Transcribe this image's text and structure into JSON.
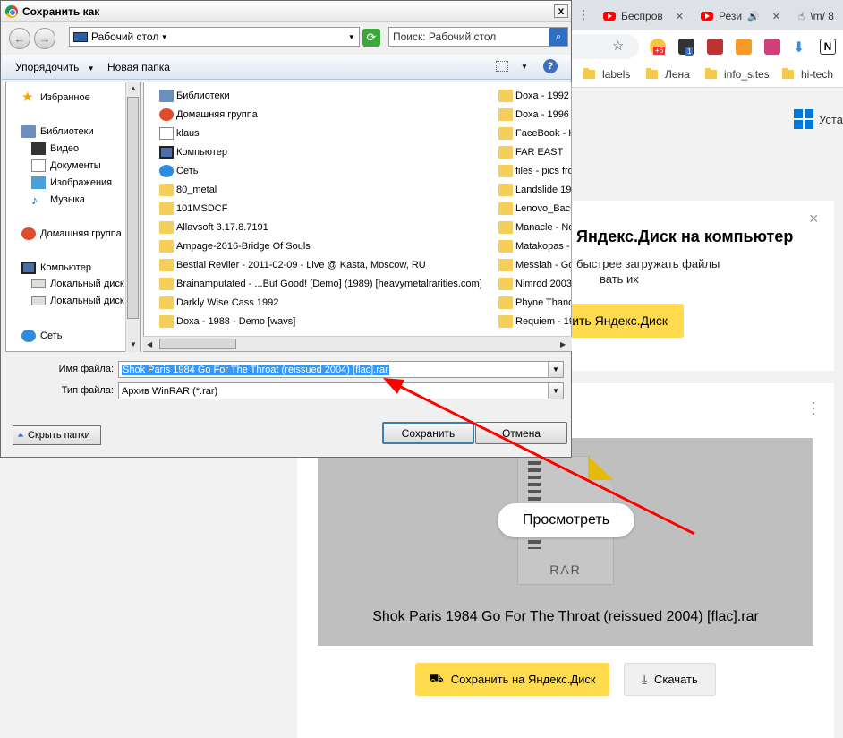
{
  "browser": {
    "tabs": [
      {
        "title": "Беспров"
      },
      {
        "title": "Рези"
      },
      {
        "title": "\\m/ 8"
      }
    ],
    "bookmarks": [
      {
        "label": "labels"
      },
      {
        "label": "Лена"
      },
      {
        "label": "info_sites"
      },
      {
        "label": "hi-tech"
      }
    ],
    "ext_badges": {
      "weather": "+6",
      "box": "1"
    }
  },
  "page": {
    "install_label": "Уста",
    "banner": {
      "title": "Яндекс.Диск на компьютер",
      "line1": "быстрее загружать файлы",
      "line2": "вать их",
      "button": "ить Яндекс.Диск",
      "close": "×"
    },
    "preview": {
      "file_type": "RAR",
      "view_button": "Просмотреть",
      "file_name": "Shok Paris 1984 Go For The Throat (reissued 2004) [flac].rar"
    },
    "save_button": "Сохранить на Яндекс.Диск",
    "download_button": "Скачать"
  },
  "dialog": {
    "title": "Сохранить как",
    "close": "x",
    "address": "Рабочий стол",
    "search_placeholder": "Поиск: Рабочий стол",
    "organize": "Упорядочить",
    "new_folder": "Новая папка",
    "help": "?",
    "nav": [
      {
        "label": "Избранное",
        "icon": "star-icon"
      },
      {
        "label": "Библиотеки",
        "icon": "library-icon"
      },
      {
        "label": "Видео",
        "icon": "video-icon"
      },
      {
        "label": "Документы",
        "icon": "documents-icon"
      },
      {
        "label": "Изображения",
        "icon": "images-icon"
      },
      {
        "label": "Музыка",
        "icon": "music-icon"
      },
      {
        "label": "Домашняя группа",
        "icon": "homegroup-icon"
      },
      {
        "label": "Компьютер",
        "icon": "computer-icon"
      },
      {
        "label": "Локальный диск",
        "icon": "drive-icon"
      },
      {
        "label": "Локальный диск",
        "icon": "drive-icon"
      },
      {
        "label": "Сеть",
        "icon": "network-icon"
      }
    ],
    "files_col1": [
      {
        "name": "Библиотеки",
        "icon": "library-icon"
      },
      {
        "name": "Домашняя группа",
        "icon": "homegroup-icon"
      },
      {
        "name": "klaus",
        "icon": "user-icon"
      },
      {
        "name": "Компьютер",
        "icon": "computer-icon"
      },
      {
        "name": "Сеть",
        "icon": "network-icon"
      },
      {
        "name": "80_metal",
        "icon": "folder-icon"
      },
      {
        "name": "101MSDCF",
        "icon": "folder-icon"
      },
      {
        "name": "Allavsoft 3.17.8.7191",
        "icon": "folder-icon"
      },
      {
        "name": "Ampage-2016-Bridge Of Souls",
        "icon": "folder-icon"
      },
      {
        "name": "Bestial Reviler - 2011-02-09 - Live @ Kasta, Moscow, RU",
        "icon": "folder-icon"
      },
      {
        "name": "Brainamputated - ...But Good! [Demo] (1989) [heavymetalrarities.com]",
        "icon": "folder-icon"
      },
      {
        "name": "Darkly Wise Cass 1992",
        "icon": "folder-icon"
      },
      {
        "name": "Doxa - 1988 - Demo [wavs]",
        "icon": "folder-icon"
      }
    ],
    "files_col2": [
      {
        "name": "Doxa - 1992 - "
      },
      {
        "name": "Doxa - 1996 - "
      },
      {
        "name": "FaceBook - Kl"
      },
      {
        "name": "FAR EAST"
      },
      {
        "name": "files - pics fro"
      },
      {
        "name": "Landslide 198"
      },
      {
        "name": "Lenovo_Backl"
      },
      {
        "name": "Manacle - No "
      },
      {
        "name": "Matakopas - C"
      },
      {
        "name": "Messiah - Goi"
      },
      {
        "name": "Nimrod 2003 -"
      },
      {
        "name": "Phyne Thanq"
      },
      {
        "name": "Requiem - 19"
      }
    ],
    "filename_label": "Имя файла:",
    "filename_value": "Shok Paris 1984 Go For The Throat (reissued 2004) [flac].rar",
    "filetype_label": "Тип файла:",
    "filetype_value": "Архив WinRAR (*.rar)",
    "hide_folders": "Скрыть папки",
    "save": "Сохранить",
    "cancel": "Отмена"
  },
  "colors": {
    "accent_yellow": "#ffdb4d",
    "selection_blue": "#3399ff",
    "annotation_red": "#ff0000"
  }
}
